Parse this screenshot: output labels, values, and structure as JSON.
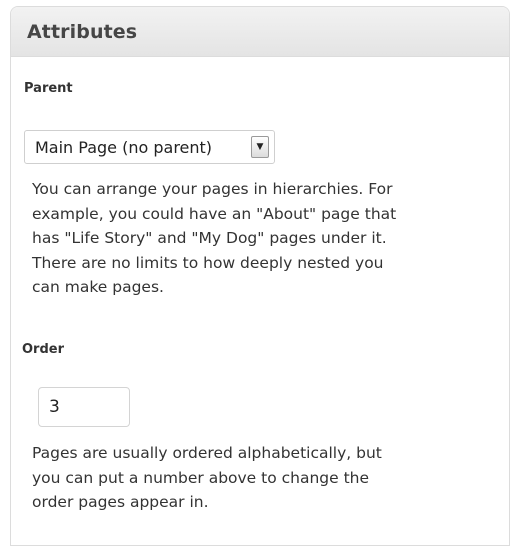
{
  "panel": {
    "title": "Attributes"
  },
  "parent": {
    "label": "Parent",
    "selected": "Main Page (no parent)",
    "help_lines": [
      "You can arrange your pages in hierarchies. For",
      "example, you could have an \"About\" page that",
      "has \"Life Story\" and \"My Dog\" pages under it.",
      "There are no limits to how deeply nested you",
      "can make pages."
    ]
  },
  "order": {
    "label": "Order",
    "value": "3",
    "help_lines": [
      "Pages are usually ordered alphabetically, but",
      "you can put a number above to change the",
      "order pages appear in."
    ]
  }
}
